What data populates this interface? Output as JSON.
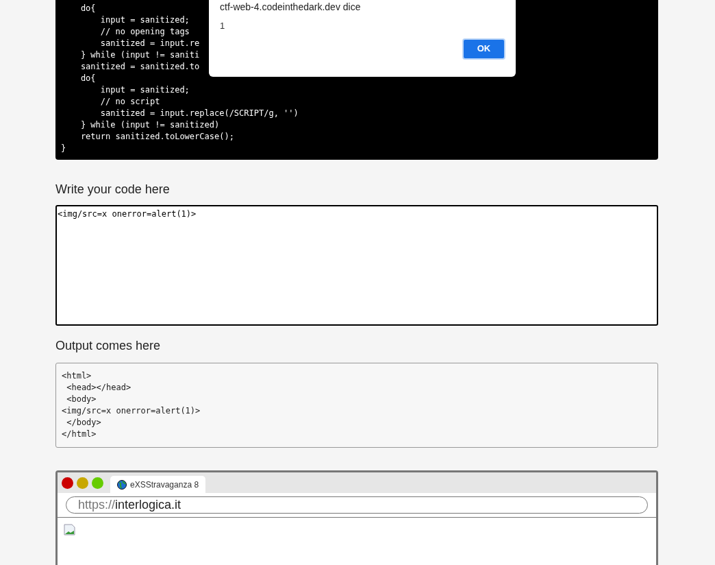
{
  "code_block": {
    "lines": [
      "    do{",
      "        input = sanitized;",
      "        // no opening tags",
      "        sanitized = input.re",
      "    } while (input != saniti",
      "    sanitized = sanitized.to",
      "    do{",
      "        input = sanitized;",
      "        // no script",
      "        sanitized = input.replace(/SCRIPT/g, '')",
      "    } while (input != sanitized)",
      "    return sanitized.toLowerCase();",
      "}"
    ]
  },
  "alert_dialog": {
    "title": "ctf-web-4.codeinthedark.dev dice",
    "message": "1",
    "button": "OK"
  },
  "code_input": {
    "label": "Write your code here",
    "value": "<img/src=x onerror=alert(1)>"
  },
  "output": {
    "label": "Output comes here",
    "lines": [
      "<html>",
      " <head></head>",
      " <body>",
      "<img/src=x onerror=alert(1)>",
      " </body>",
      "</html>"
    ]
  },
  "browser_preview": {
    "tab": "eXSStravaganza 8",
    "url_scheme": "https://",
    "url_host": "interlogica.it"
  }
}
